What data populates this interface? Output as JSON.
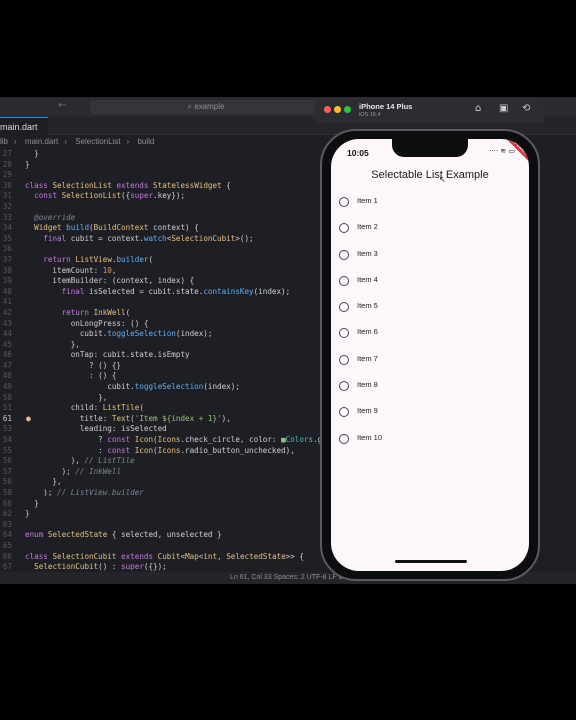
{
  "editor": {
    "search_text": "⌕ example",
    "nav_arrows": "← →",
    "tab_label": "main.dart",
    "breadcrumb": [
      "lib",
      "main.dart",
      "SelectionList",
      "build"
    ],
    "status": "Ln 61, Col 33   Spaces: 2   UTF-8   LF   Dart   iOS simulator"
  },
  "simulator": {
    "device": "iPhone 14 Plus",
    "os": "iOS 16.4",
    "dots": [
      "#ff5f57",
      "#febc2e",
      "#28c840"
    ],
    "icons": [
      "home-icon",
      "screenshot-icon",
      "rotate-icon"
    ]
  },
  "app": {
    "time": "10:05",
    "status_icons": "···· ≋ ▭",
    "debug_banner": "DEBUG",
    "title": "Selectable List Example",
    "items": [
      "Item 1",
      "Item 2",
      "Item 3",
      "Item 4",
      "Item 5",
      "Item 6",
      "Item 7",
      "Item 8",
      "Item 9",
      "Item 10"
    ]
  }
}
